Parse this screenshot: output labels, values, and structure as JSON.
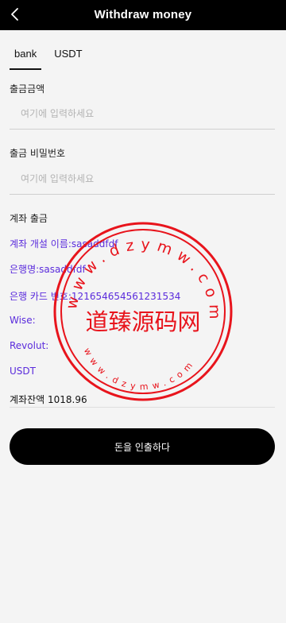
{
  "header": {
    "title": "Withdraw money",
    "back_icon": "chevron-left-icon"
  },
  "tabs": [
    {
      "label": "bank",
      "active": true
    },
    {
      "label": "USDT",
      "active": false
    }
  ],
  "amount": {
    "label": "출금금액",
    "placeholder": "여기에 입력하세요",
    "value": ""
  },
  "password": {
    "label": "출금 비밀번호",
    "placeholder": "여기에 입력하세요",
    "value": ""
  },
  "account_section": {
    "title": "계좌 출금",
    "lines": [
      {
        "label": "계좌 개설 이름:",
        "value": "sasaddfdf"
      },
      {
        "label": "은행명:",
        "value": "sasaddfdf"
      },
      {
        "label": "은행 카드 번호:",
        "value": "121654654561231534"
      },
      {
        "label": "Wise:",
        "value": ""
      },
      {
        "label": "Revolut:",
        "value": ""
      },
      {
        "label": "USDT",
        "value": ""
      }
    ]
  },
  "balance": {
    "label": "계좌잔액",
    "value": "1018.96"
  },
  "submit": {
    "label": "돈을 인출하다"
  },
  "watermark": {
    "center_text": "道臻源码网",
    "ring_text_top": "www.dzymw.com",
    "ring_text_bottom": "www.dzymw.com",
    "color": "#e8141c"
  },
  "colors": {
    "header_bg": "#000000",
    "accent_purple": "#5a2bdc",
    "page_bg": "#f4f4f4"
  }
}
